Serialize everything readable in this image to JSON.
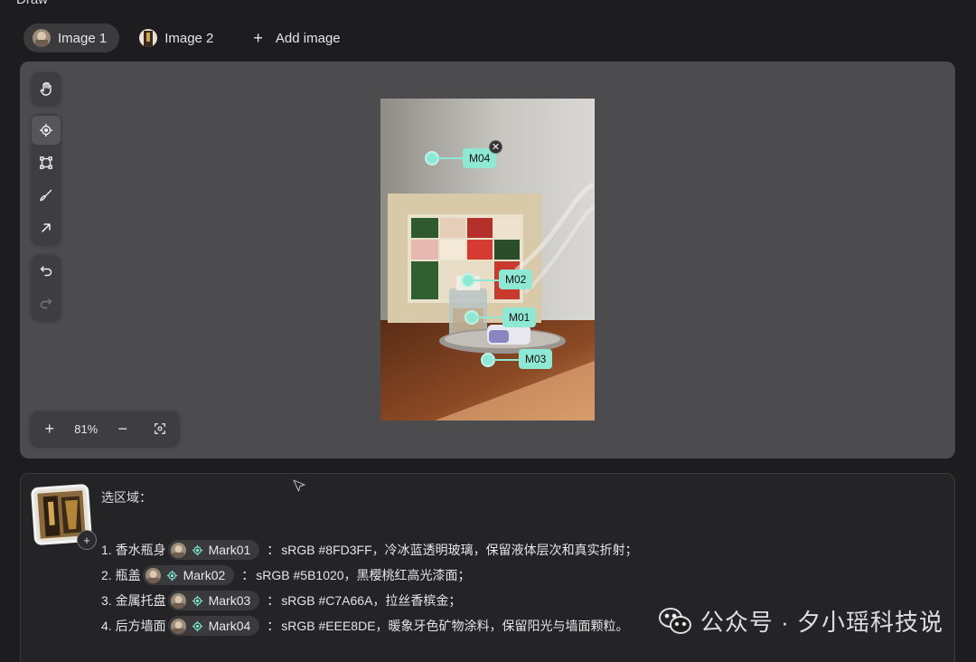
{
  "app": {
    "title": "Draw"
  },
  "tabs": [
    {
      "label": "Image 1",
      "active": true
    },
    {
      "label": "Image 2",
      "active": false
    }
  ],
  "add_image": {
    "icon": "plus-icon",
    "label": "Add image"
  },
  "toolbar": {
    "groups": [
      [
        "hand-icon"
      ],
      [
        "target-icon",
        "crop-icon",
        "brush-icon",
        "arrow-icon"
      ],
      [
        "undo-icon",
        "redo-icon"
      ]
    ],
    "active_tool": "target-icon"
  },
  "zoom": {
    "value": "81%"
  },
  "markers": [
    {
      "label": "M04"
    },
    {
      "label": "M02"
    },
    {
      "label": "M01"
    },
    {
      "label": "M03"
    }
  ],
  "prompt": {
    "heading": "选区域：",
    "items": [
      {
        "index": "1.",
        "subject": "香水瓶身",
        "mark": "Mark01",
        "desc": "sRGB #8FD3FF，冷冰蓝透明玻璃，保留液体层次和真实折射；"
      },
      {
        "index": "2.",
        "subject": "瓶盖",
        "mark": "Mark02",
        "desc": "sRGB #5B1020，黑樱桃红高光漆面；"
      },
      {
        "index": "3.",
        "subject": "金属托盘",
        "mark": "Mark03",
        "desc": "sRGB #C7A66A，拉丝香槟金；"
      },
      {
        "index": "4.",
        "subject": "后方墙面",
        "mark": "Mark04",
        "desc": "sRGB #EEE8DE，暖象牙色矿物涂料，保留阳光与墙面颗粒。"
      }
    ],
    "separator": "："
  },
  "watermark": {
    "text": "公众号 · 夕小瑶科技说"
  },
  "colors": {
    "background": "#1d1d1f",
    "canvas": "#4c4c4e",
    "marker": "#8fe8d4",
    "panel": "#242426"
  }
}
